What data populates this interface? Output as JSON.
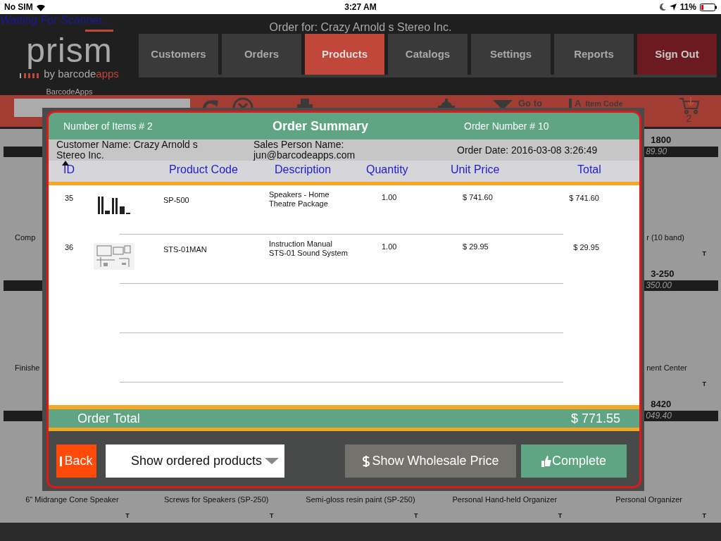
{
  "status_bar": {
    "carrier": "No SIM",
    "time": "3:27 AM",
    "battery": "11%"
  },
  "header": {
    "scanner_status": "Waiting For Scanner...",
    "order_for": "Order for: Crazy Arnold s Stereo Inc.",
    "logo": {
      "word": "prism",
      "tagline": "by barcode",
      "tagline_accent": "apps",
      "caption": "BarcodeApps"
    },
    "nav": [
      {
        "label": "Customers",
        "selected": false,
        "kind": "normal"
      },
      {
        "label": "Orders",
        "selected": false,
        "kind": "normal"
      },
      {
        "label": "Products",
        "selected": true,
        "kind": "normal"
      },
      {
        "label": "Catalogs",
        "selected": false,
        "kind": "normal"
      },
      {
        "label": "Settings",
        "selected": false,
        "kind": "normal"
      },
      {
        "label": "Reports",
        "selected": false,
        "kind": "normal"
      },
      {
        "label": "Sign Out",
        "selected": false,
        "kind": "signout"
      }
    ]
  },
  "toolbar": {
    "text_size": "A",
    "goto": "Go to",
    "item_code": "Item Code",
    "cart_count": "2"
  },
  "product_grid": {
    "rows": [
      {
        "kind": "partial",
        "left": {
          "name": "Comp"
        },
        "right": {
          "code": "1800",
          "price": "89.90",
          "name": "r (10 band)",
          "mark": "T"
        }
      },
      {
        "kind": "partial",
        "left": {
          "name": "Finishe"
        },
        "right": {
          "code": "3-250",
          "price": "350.00",
          "name": "nent Center",
          "mark": "T"
        }
      },
      {
        "kind": "full",
        "tiles": [
          {
            "name": "6\" Midrange Cone Speaker",
            "mark": "T"
          },
          {
            "name": "Screws for Speakers (SP-250)",
            "mark": "T"
          },
          {
            "name": "Semi-gloss resin paint (SP-250)",
            "mark": "T"
          },
          {
            "name": "Personal Hand-held Organizer",
            "mark": "T"
          },
          {
            "code": "8420",
            "price": "049.40",
            "name": "Personal Organizer",
            "mark": "T"
          }
        ]
      }
    ]
  },
  "order_summary": {
    "item_count": "Number of Items # 2",
    "title": "Order Summary",
    "order_number": "Order Number # 10",
    "customer": "Customer Name: Crazy Arnold s Stereo Inc.",
    "sales_person": "Sales Person Name: jun@barcodeapps.com",
    "order_date": "Order Date:  2016-03-08 3:26:49",
    "columns": [
      "ID",
      "Product Code",
      "Description",
      "Quantity",
      "Unit Price",
      "Total"
    ],
    "rows": [
      {
        "id": "35",
        "product_code": "SP-500",
        "description": "Speakers - Home Theatre Package",
        "quantity": "1.00",
        "unit_price": "$ 741.60",
        "total": "$ 741.60"
      },
      {
        "id": "36",
        "product_code": "STS-01MAN",
        "description": "Instruction Manual STS-01 Sound System",
        "quantity": "1.00",
        "unit_price": "$ 29.95",
        "total": "$ 29.95"
      }
    ],
    "total_label": "Order Total",
    "total": "$ 771.55",
    "buttons": {
      "back": "Back",
      "filter": "Show ordered products",
      "wholesale": "Show Wholesale Price",
      "complete": "Complete"
    }
  }
}
